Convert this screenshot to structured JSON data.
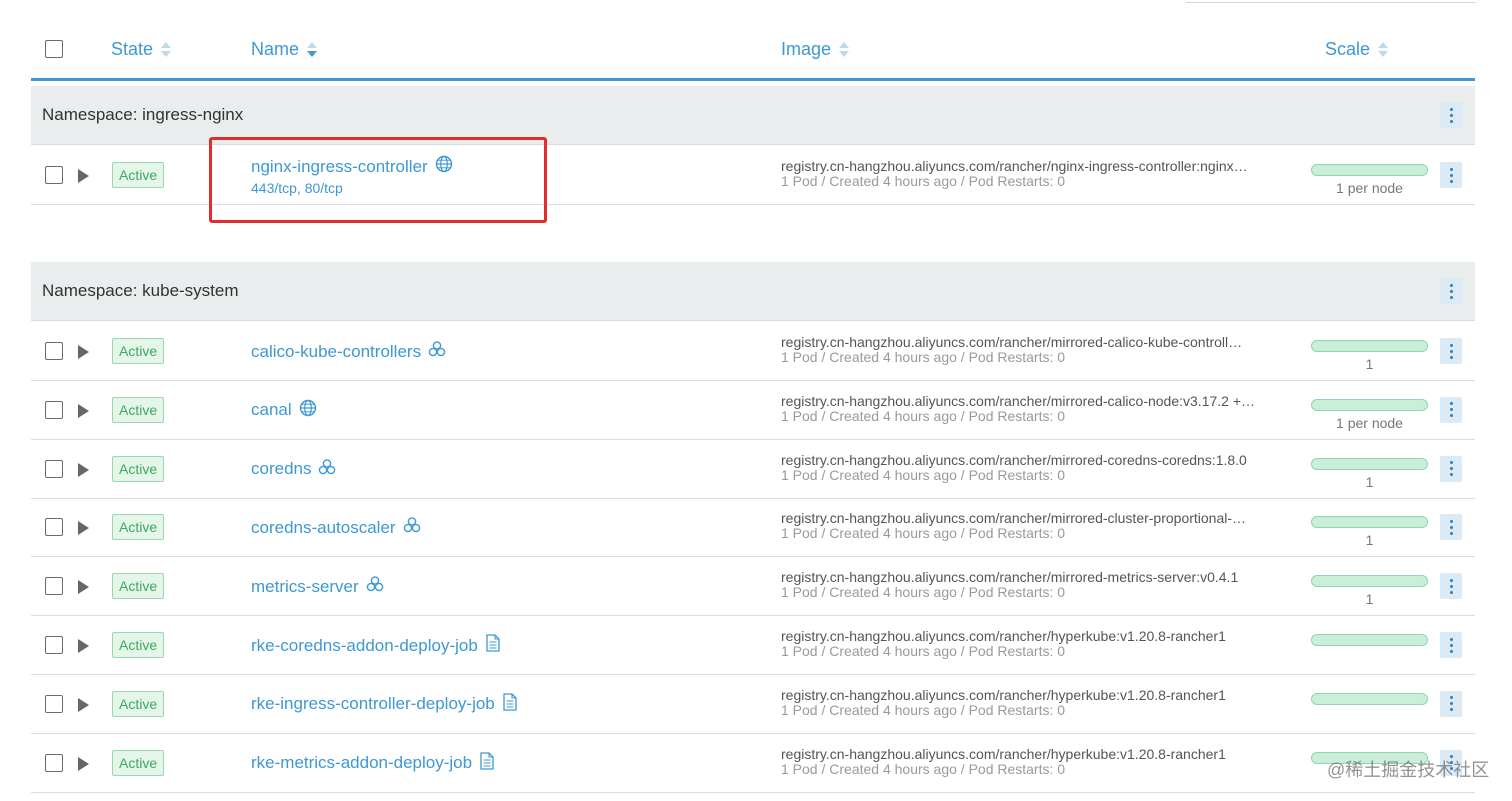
{
  "table": {
    "columns": {
      "state": "State",
      "name": "Name",
      "image": "Image",
      "scale": "Scale"
    }
  },
  "groups": [
    {
      "namespace": "Namespace: ingress-nginx",
      "rows": [
        {
          "state": "Active",
          "name": "nginx-ingress-controller",
          "icon": "globe-icon",
          "ports": "443/tcp, 80/tcp",
          "image": "registry.cn-hangzhou.aliyuncs.com/rancher/nginx-ingress-controller:nginx…",
          "meta": "1 Pod / Created 4 hours ago / Pod Restarts: 0",
          "scale": "1 per node"
        }
      ]
    },
    {
      "namespace": "Namespace: kube-system",
      "rows": [
        {
          "state": "Active",
          "name": "calico-kube-controllers",
          "icon": "cluster-icon",
          "image": "registry.cn-hangzhou.aliyuncs.com/rancher/mirrored-calico-kube-controll…",
          "meta": "1 Pod / Created 4 hours ago / Pod Restarts: 0",
          "scale": "1"
        },
        {
          "state": "Active",
          "name": "canal",
          "icon": "globe-icon",
          "image": "registry.cn-hangzhou.aliyuncs.com/rancher/mirrored-calico-node:v3.17.2 +…",
          "meta": "1 Pod / Created 4 hours ago / Pod Restarts: 0",
          "scale": "1 per node"
        },
        {
          "state": "Active",
          "name": "coredns",
          "icon": "cluster-icon",
          "image": "registry.cn-hangzhou.aliyuncs.com/rancher/mirrored-coredns-coredns:1.8.0",
          "meta": "1 Pod / Created 4 hours ago / Pod Restarts: 0",
          "scale": "1"
        },
        {
          "state": "Active",
          "name": "coredns-autoscaler",
          "icon": "cluster-icon",
          "image": "registry.cn-hangzhou.aliyuncs.com/rancher/mirrored-cluster-proportional-…",
          "meta": "1 Pod / Created 4 hours ago / Pod Restarts: 0",
          "scale": "1"
        },
        {
          "state": "Active",
          "name": "metrics-server",
          "icon": "cluster-icon",
          "image": "registry.cn-hangzhou.aliyuncs.com/rancher/mirrored-metrics-server:v0.4.1",
          "meta": "1 Pod / Created 4 hours ago / Pod Restarts: 0",
          "scale": "1"
        },
        {
          "state": "Active",
          "name": "rke-coredns-addon-deploy-job",
          "icon": "document-icon",
          "image": "registry.cn-hangzhou.aliyuncs.com/rancher/hyperkube:v1.20.8-rancher1",
          "meta": "1 Pod / Created 4 hours ago / Pod Restarts: 0",
          "scale": ""
        },
        {
          "state": "Active",
          "name": "rke-ingress-controller-deploy-job",
          "icon": "document-icon",
          "image": "registry.cn-hangzhou.aliyuncs.com/rancher/hyperkube:v1.20.8-rancher1",
          "meta": "1 Pod / Created 4 hours ago / Pod Restarts: 0",
          "scale": ""
        },
        {
          "state": "Active",
          "name": "rke-metrics-addon-deploy-job",
          "icon": "document-icon",
          "image": "registry.cn-hangzhou.aliyuncs.com/rancher/hyperkube:v1.20.8-rancher1",
          "meta": "1 Pod / Created 4 hours ago / Pod Restarts: 0",
          "scale": ""
        }
      ]
    }
  ],
  "watermark": "@稀土掘金技术社区",
  "colors": {
    "accent": "#3d98d3",
    "active_green": "#3fa860",
    "highlight_red": "#e02d2d"
  }
}
